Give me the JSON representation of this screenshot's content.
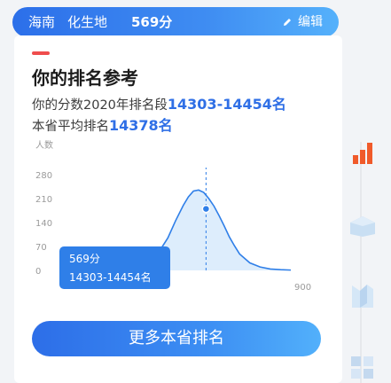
{
  "header": {
    "province": "海南",
    "subjects": "化生地",
    "score": "569分",
    "edit_label": "编辑"
  },
  "card": {
    "title": "你的排名参考",
    "rank_prefix": "你的分数2020年排名段",
    "rank_range": "14303-14454名",
    "avg_prefix": "本省平均排名",
    "avg_rank": "14378名",
    "more_button": "更多本省排名"
  },
  "chart_data": {
    "type": "area",
    "title": "",
    "ylabel": "人数",
    "xlabel": "",
    "y_ticks": [
      "280",
      "210",
      "140",
      "70",
      "0"
    ],
    "x_ticks_visible": [
      "900"
    ],
    "ylim": [
      0,
      280
    ],
    "xlim": [
      0,
      900
    ],
    "x": [
      300,
      340,
      380,
      420,
      450,
      480,
      500,
      520,
      540,
      560,
      580,
      600,
      620,
      640,
      660,
      680,
      700,
      740,
      780,
      820,
      860,
      900
    ],
    "y": [
      5,
      18,
      48,
      95,
      145,
      190,
      215,
      232,
      235,
      228,
      210,
      188,
      160,
      130,
      98,
      72,
      48,
      22,
      10,
      4,
      2,
      1
    ],
    "marker": {
      "x": 569,
      "y": 180
    },
    "tooltip": {
      "score": "569分",
      "rank": "14303-14454名"
    },
    "grid": false,
    "colors": {
      "line": "#2f7fe8",
      "fill": "#cfe6fb",
      "marker": "#2f7fe8",
      "tooltip_bg": "#2f7fe8"
    }
  },
  "side_icons": [
    "bar-chart-icon",
    "cube-icon",
    "map-icon",
    "grid-icon"
  ]
}
